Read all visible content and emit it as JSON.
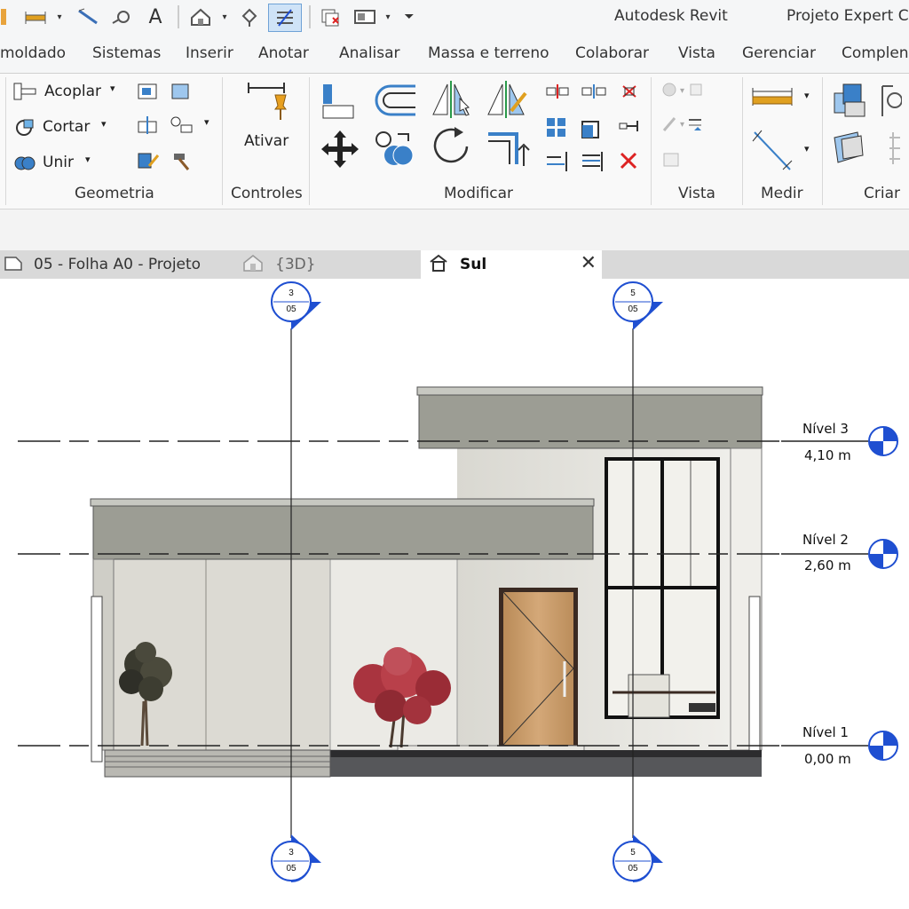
{
  "window": {
    "app_title": "Autodesk Revit",
    "project_title": "Projeto Expert C"
  },
  "ribbon_tabs": [
    "moldado",
    "Sistemas",
    "Inserir",
    "Anotar",
    "Analisar",
    "Massa e terreno",
    "Colaborar",
    "Vista",
    "Gerenciar",
    "Complen"
  ],
  "ribbon": {
    "geometria": {
      "acoplar": "Acoplar",
      "cortar": "Cortar",
      "unir": "Unir",
      "panel_label": "Geometria"
    },
    "controles": {
      "ativar": "Ativar",
      "panel_label": "Controles"
    },
    "modificar": {
      "panel_label": "Modificar"
    },
    "vista": {
      "panel_label": "Vista"
    },
    "medir": {
      "panel_label": "Medir"
    },
    "criar": {
      "panel_label": "Criar"
    }
  },
  "view_tabs": [
    {
      "label": "05 - Folha A0 - Projeto",
      "icon": "sheet-icon"
    },
    {
      "label": "{3D}",
      "icon": "house-3d-icon"
    },
    {
      "label": "Sul",
      "icon": "elevation-house-icon",
      "active": true
    }
  ],
  "elevation": {
    "levels": [
      {
        "name": "Nível 3",
        "value": "4,10 m"
      },
      {
        "name": "Nível 2",
        "value": "2,60 m"
      },
      {
        "name": "Nível 1",
        "value": "0,00 m"
      }
    ],
    "grid_bubbles": [
      {
        "top": "3",
        "bottom": "05"
      },
      {
        "top": "5",
        "bottom": "05"
      }
    ]
  },
  "colors": {
    "grid_blue": "#1f4fd1",
    "roof_grey": "#9c9d94",
    "wall_light": "#e9e8e2",
    "door_wood": "#c79a68"
  }
}
